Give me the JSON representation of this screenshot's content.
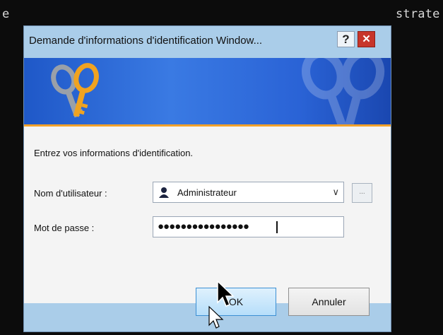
{
  "console": {
    "left_text": "e",
    "right_text": "strate"
  },
  "dialog": {
    "title": "Demande d'informations d'identification Window...",
    "help_label": "?",
    "close_label": "✕",
    "prompt": "Entrez vos informations d'identification.",
    "username_label": "Nom d'utilisateur :",
    "username_value": "Administrateur",
    "browse_label": "...",
    "password_label": "Mot de passe :",
    "password_mask": "●●●●●●●●●●●●●●●●",
    "ok_label": "OK",
    "cancel_label": "Annuler"
  },
  "colors": {
    "banner": "#2a63d6",
    "accent_stripe": "#f2a12a",
    "close": "#c7352a",
    "frame": "#aacde9"
  },
  "icons": {
    "banner": "keys-icon",
    "user": "user-avatar-icon",
    "dropdown": "chevron-down-icon",
    "pointer": "mouse-pointer-icon"
  }
}
